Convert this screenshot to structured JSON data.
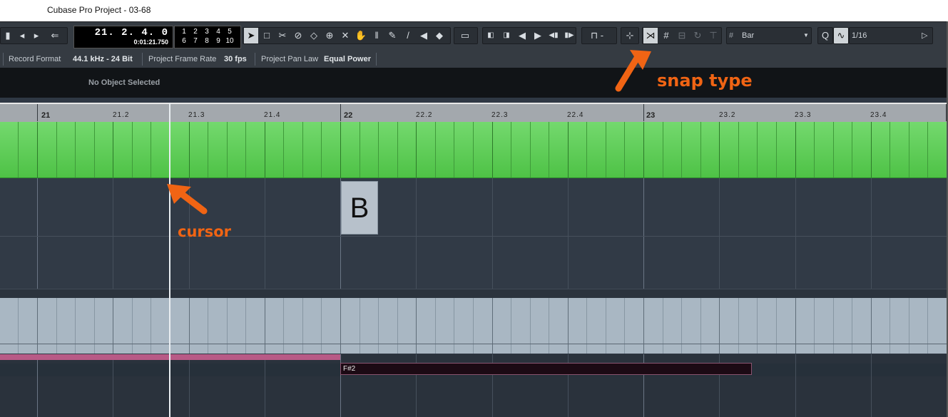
{
  "window": {
    "title": "Cubase Pro Project - 03-68"
  },
  "transport": {
    "position": "21. 2. 4.   0",
    "time": "0:01:21.750",
    "markers": [
      "1",
      "2",
      "3",
      "4",
      "5",
      "6",
      "7",
      "8",
      "9",
      "10"
    ]
  },
  "toolbar": {
    "snap_type_value": "Bar",
    "quantize_value": "1/16",
    "quantize_label": "Q",
    "icons": [
      "nav-back-icon",
      "nav-left-icon",
      "nav-right-icon",
      "return-icon",
      "arrow-select-icon",
      "range-select-icon",
      "split-icon",
      "glue-icon",
      "erase-icon",
      "zoom-icon",
      "mute-icon",
      "hand-icon",
      "comp-icon",
      "draw-icon",
      "speaker-icon",
      "color-icon",
      "go-start-icon",
      "go-end-icon",
      "rewind-icon",
      "forward-icon",
      "prev-marker-icon",
      "next-marker-icon",
      "autoscroll-icon",
      "snap-icon",
      "grid-icon"
    ]
  },
  "info_line": {
    "record_format_label": "Record Format",
    "record_format_value": "44.1 kHz - 24 Bit",
    "frame_rate_label": "Project Frame Rate",
    "frame_rate_value": "30 fps",
    "pan_law_label": "Project Pan Law",
    "pan_law_value": "Equal Power"
  },
  "inspector": {
    "status": "No Object Selected"
  },
  "ruler": {
    "labels": [
      "21",
      "21.2",
      "21.3",
      "21.4",
      "22",
      "22.2",
      "22.3",
      "22.4",
      "23",
      "23.2",
      "23.3",
      "23.4"
    ]
  },
  "tracks": {
    "marker_letter": "B",
    "midi_note": "F#2"
  },
  "annotations": {
    "snap_type": "snap type",
    "cursor": "cursor"
  },
  "colors": {
    "annotation": "#f06414",
    "green_track": "#5fcd58",
    "pink_part": "#b85a86"
  }
}
